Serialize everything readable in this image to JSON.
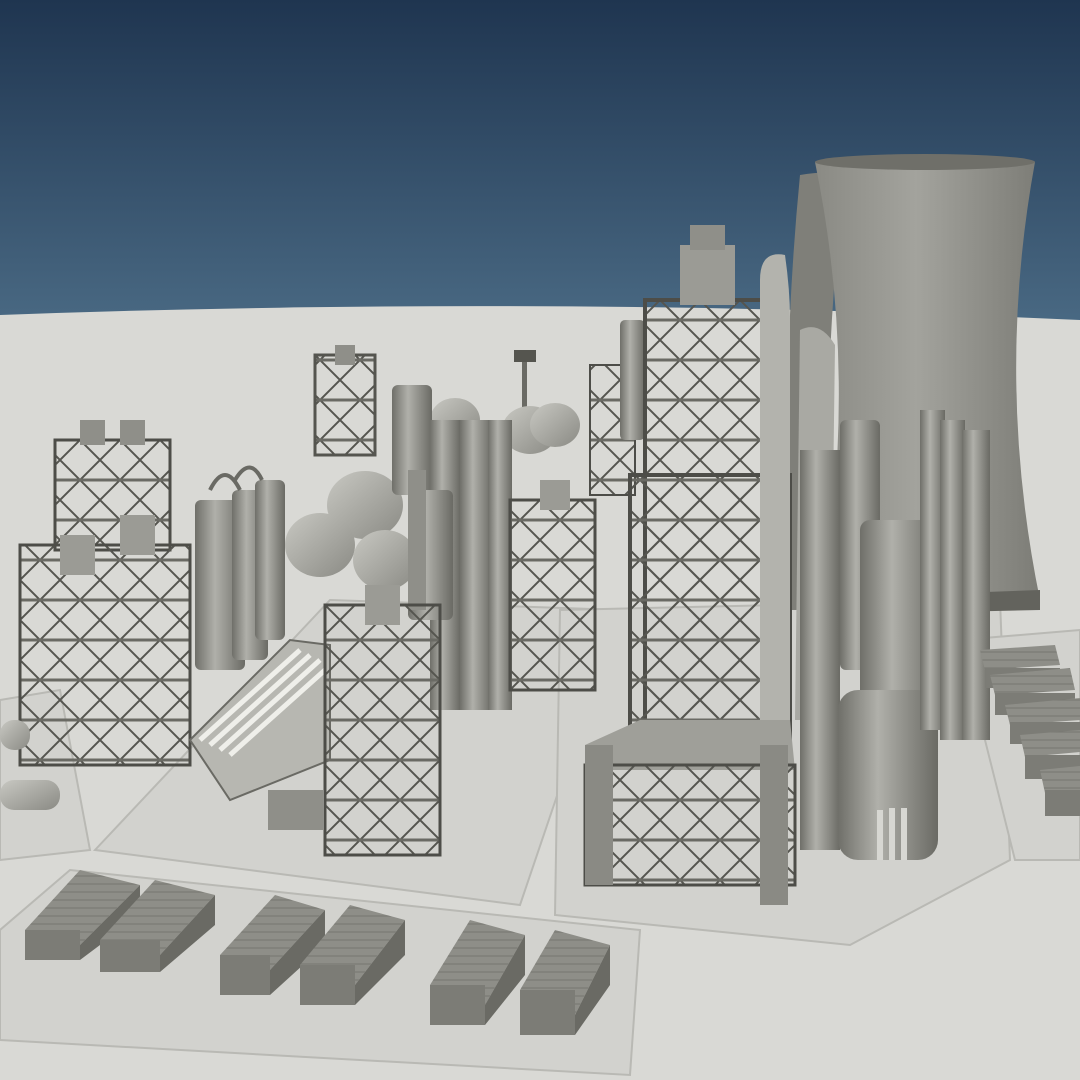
{
  "scene": {
    "colors": {
      "sky_top": "#1f3550",
      "sky_bottom": "#4a6a84",
      "ground": "#d9d9d5",
      "pad": "#cfcfcb",
      "metal_light": "#b4b4ae",
      "metal_mid": "#8f8f89",
      "metal_dark": "#55554f",
      "tower": "#9b9b95",
      "tower_shadow": "#7f7f79"
    }
  }
}
